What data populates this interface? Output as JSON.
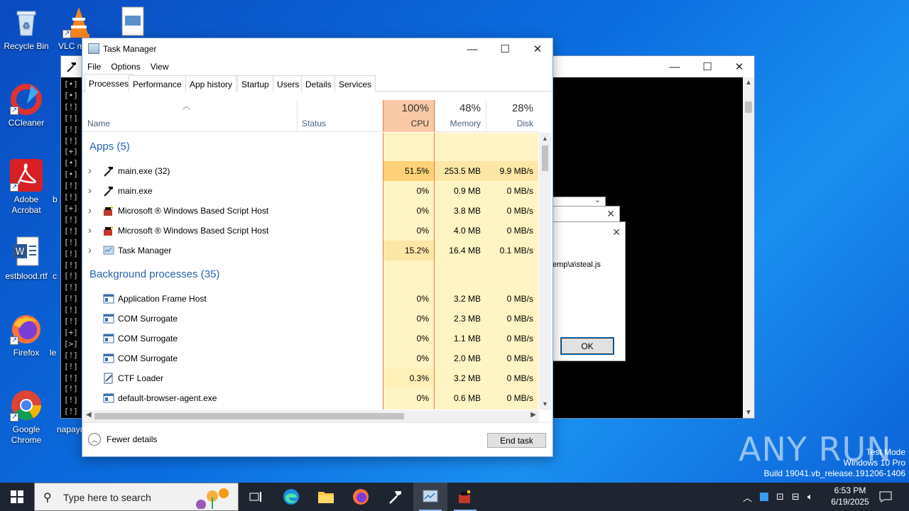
{
  "desktop": {
    "icons": [
      {
        "label": "Recycle Bin"
      },
      {
        "label": "VLC m"
      },
      {
        "label": "CCleaner"
      },
      {
        "label": "Adobe Acrobat"
      },
      {
        "label": "estblood.rtf"
      },
      {
        "label": "Firefox"
      },
      {
        "label": "Google Chrome"
      },
      {
        "label": "napayr"
      }
    ],
    "partial_labels": [
      "b",
      "c",
      "le"
    ]
  },
  "console": {
    "lines": [
      "[•]",
      "[•]",
      "[!]",
      "[!]",
      "[!]",
      "[!]",
      "[+]",
      "[•]",
      "[•]",
      "[!]",
      "[!]",
      "[+]",
      "[!]",
      "[!]",
      "[!]",
      "[!]",
      "[!]",
      "[!]",
      "[!]",
      "[!]",
      "[!]",
      "[!]",
      "[+]",
      "[>]",
      "[!]",
      "[!]",
      "[!]",
      "[!]",
      "[!]",
      "[!]"
    ]
  },
  "dialog": {
    "text": "emp\\a\\steal.js",
    "ok_label": "OK"
  },
  "taskmanager": {
    "title": "Task Manager",
    "menu": [
      "File",
      "Options",
      "View"
    ],
    "tabs": [
      "Processes",
      "Performance",
      "App history",
      "Startup",
      "Users",
      "Details",
      "Services"
    ],
    "columns": {
      "name": "Name",
      "status": "Status",
      "cpu": {
        "pct": "100%",
        "label": "CPU"
      },
      "memory": {
        "pct": "48%",
        "label": "Memory"
      },
      "disk": {
        "pct": "28%",
        "label": "Disk"
      }
    },
    "groups": {
      "apps": "Apps (5)",
      "background": "Background processes (35)"
    },
    "apps": [
      {
        "name": "main.exe (32)",
        "cpu": "51.5%",
        "mem": "253.5 MB",
        "disk": "9.9 MB/s",
        "icon": "hammer-icon"
      },
      {
        "name": "main.exe",
        "cpu": "0%",
        "mem": "0.9 MB",
        "disk": "0 MB/s",
        "icon": "hammer-icon"
      },
      {
        "name": "Microsoft ® Windows Based Script Host",
        "cpu": "0%",
        "mem": "3.8 MB",
        "disk": "0 MB/s",
        "icon": "script-host-icon"
      },
      {
        "name": "Microsoft ® Windows Based Script Host",
        "cpu": "0%",
        "mem": "4.0 MB",
        "disk": "0 MB/s",
        "icon": "script-host-icon"
      },
      {
        "name": "Task Manager",
        "cpu": "15.2%",
        "mem": "16.4 MB",
        "disk": "0.1 MB/s",
        "icon": "task-manager-icon"
      }
    ],
    "background": [
      {
        "name": "Application Frame Host",
        "cpu": "0%",
        "mem": "3.2 MB",
        "disk": "0 MB/s",
        "icon": "window-icon"
      },
      {
        "name": "COM Surrogate",
        "cpu": "0%",
        "mem": "2.3 MB",
        "disk": "0 MB/s",
        "icon": "window-icon"
      },
      {
        "name": "COM Surrogate",
        "cpu": "0%",
        "mem": "1.1 MB",
        "disk": "0 MB/s",
        "icon": "window-icon"
      },
      {
        "name": "COM Surrogate",
        "cpu": "0%",
        "mem": "2.0 MB",
        "disk": "0 MB/s",
        "icon": "window-icon"
      },
      {
        "name": "CTF Loader",
        "cpu": "0.3%",
        "mem": "3.2 MB",
        "disk": "0 MB/s",
        "icon": "ctf-loader-icon"
      },
      {
        "name": "default-browser-agent.exe",
        "cpu": "0%",
        "mem": "0.6 MB",
        "disk": "0 MB/s",
        "icon": "window-icon"
      }
    ],
    "footer": {
      "fewer_details": "Fewer details",
      "end_task": "End task"
    }
  },
  "taskbar": {
    "search_placeholder": "Type here to search",
    "time": "6:53 PM",
    "date": "6/19/2025"
  },
  "watermark": {
    "line1": "Test Mode",
    "line2": "Windows 10 Pro",
    "line3": "Build 19041.vb_release.191206-1406",
    "brand": "ANY RUN"
  },
  "colors": {
    "cpu_header": "#f9c9a5",
    "cpu_high": "#ffd178",
    "cpu_mid": "#fde7a6",
    "cpu_low": "#fff4c4",
    "group_text": "#2862ad"
  }
}
